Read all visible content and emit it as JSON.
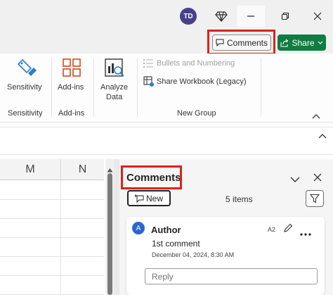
{
  "titlebar": {
    "avatar_initials": "TD",
    "diamond_icon": "premium-diamond-icon",
    "minimize_icon": "minimize-icon",
    "restore_icon": "restore-icon",
    "close_icon": "close-icon"
  },
  "top_actions": {
    "comments_label": "Comments",
    "share_label": "Share",
    "share_color": "#107c41",
    "highlight_color": "#e0201b"
  },
  "ribbon": {
    "sensitivity_button": "Sensitivity",
    "sensitivity_group": "Sensitivity",
    "addins_button": "Add-ins",
    "addins_group": "Add-ins",
    "analyze_line1": "Analyze",
    "analyze_line2": "Data",
    "bullets_label": "Bullets and Numbering",
    "share_workbook_label": "Share Workbook (Legacy)",
    "new_group_label": "New Group"
  },
  "grid": {
    "columns": [
      "M",
      "N"
    ]
  },
  "comments_pane": {
    "title": "Comments",
    "new_label": "New",
    "item_count": "5 items",
    "comment": {
      "avatar_initial": "A",
      "author": "Author",
      "cell_ref": "A2",
      "text": "1st comment",
      "timestamp": "December 04, 2024, 8:30 AM",
      "reply_placeholder": "Reply"
    }
  }
}
